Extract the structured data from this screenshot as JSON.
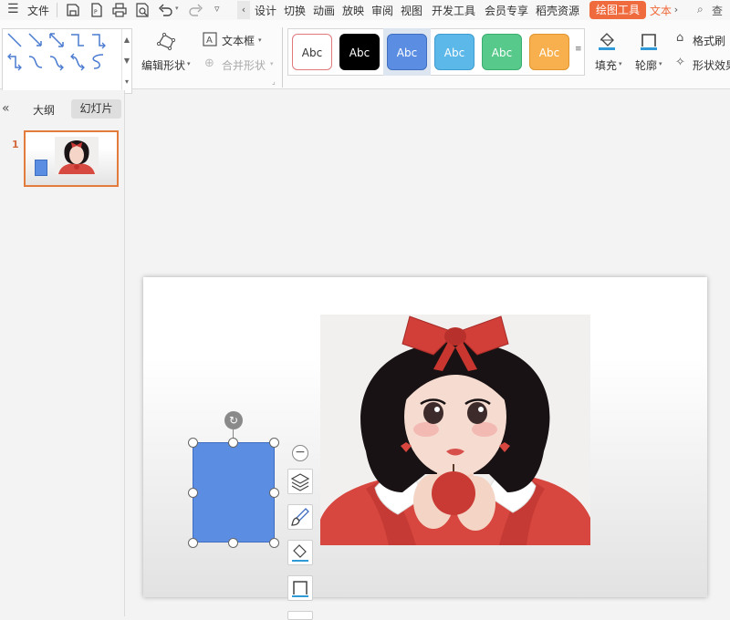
{
  "menu": {
    "file_label": "文件",
    "tabs": [
      "设计",
      "切换",
      "动画",
      "放映",
      "审阅",
      "视图",
      "开发工具",
      "会员专享",
      "稻壳资源"
    ],
    "drawing_tools": "绘图工具",
    "text_tools": "文本",
    "search_label": "查找"
  },
  "ribbon": {
    "edit_shape": "编辑形状",
    "text_box": "文本框",
    "merge_shape": "合并形状",
    "style_swatches": [
      {
        "label": "Abc",
        "bg": "#ffffff",
        "fg": "#333333",
        "border": "#e07a7a"
      },
      {
        "label": "Abc",
        "bg": "#000000",
        "fg": "#ffffff",
        "border": "#000000"
      },
      {
        "label": "Abc",
        "bg": "#5b8ee3",
        "fg": "#ffffff",
        "border": "#3f6dc0"
      },
      {
        "label": "Abc",
        "bg": "#5bb8e8",
        "fg": "#ffffff",
        "border": "#3f9cd0"
      },
      {
        "label": "Abc",
        "bg": "#57c98b",
        "fg": "#ffffff",
        "border": "#3aae70"
      },
      {
        "label": "Abc",
        "bg": "#f7b04d",
        "fg": "#ffffff",
        "border": "#e0952e"
      }
    ],
    "fill": "填充",
    "outline": "轮廓",
    "format_painter": "格式刷",
    "shape_effect": "形状效果"
  },
  "left_panel": {
    "tab_outline": "大纲",
    "tab_slides": "幻灯片",
    "slide_number": "1"
  },
  "colors": {
    "accent": "#ef6a3c",
    "shape_fill": "#5b8ee3"
  }
}
